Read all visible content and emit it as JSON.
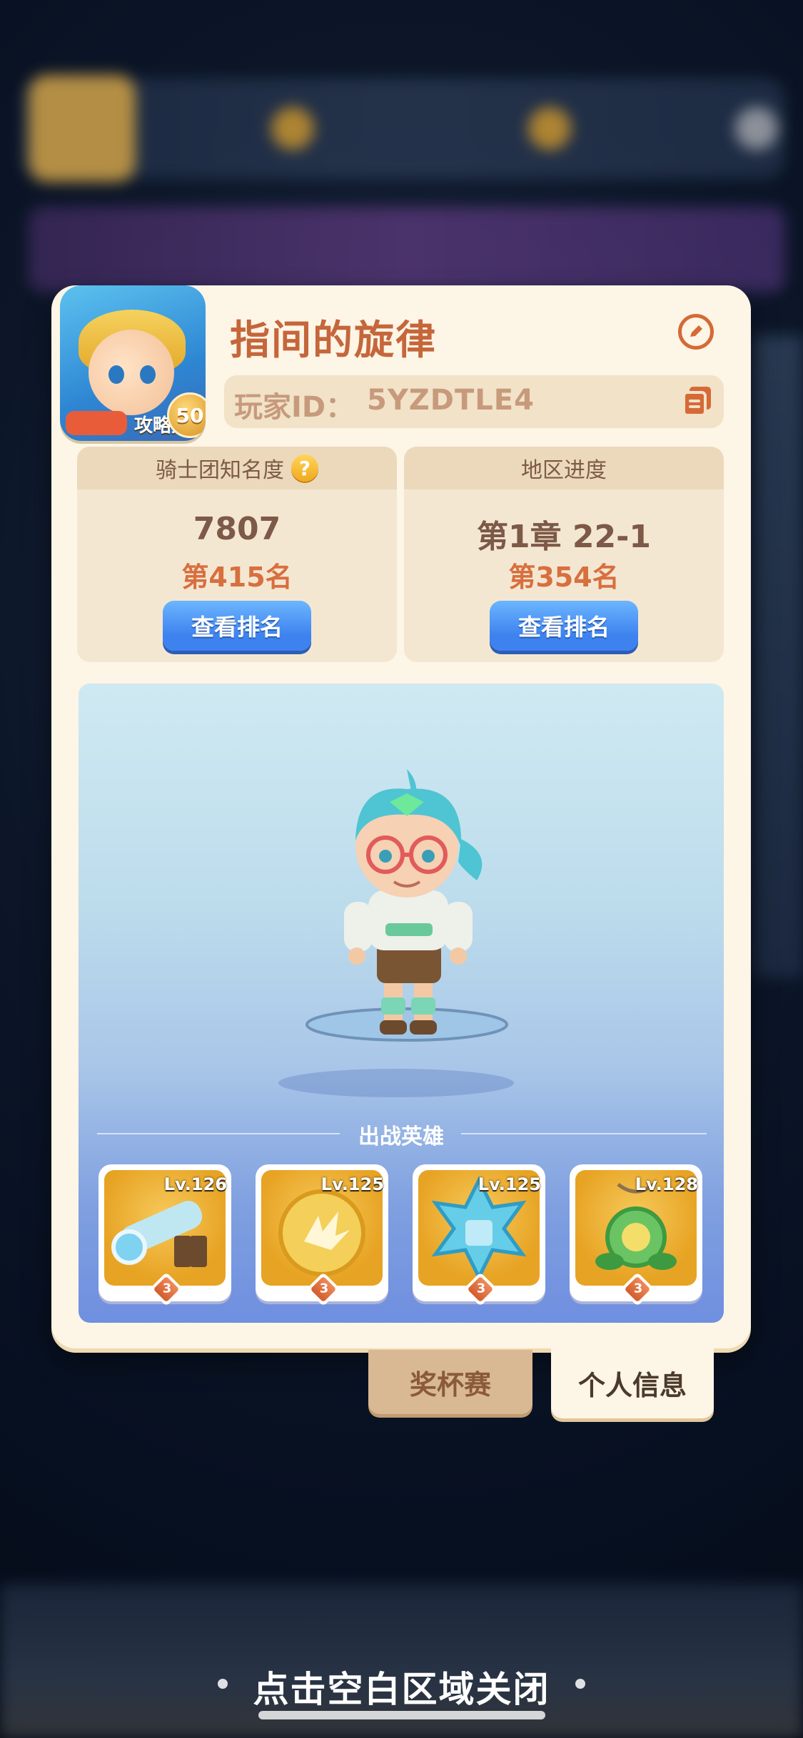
{
  "profile": {
    "name": "指间的旋律",
    "id_label": "玩家ID：",
    "id_value": "5YZDTLE4",
    "avatar_level": "50",
    "avatar_caption": "攻略大"
  },
  "stats": {
    "left": {
      "title": "骑士团知名度",
      "value": "7807",
      "rank": "第415名",
      "button": "查看排名"
    },
    "right": {
      "title": "地区进度",
      "value": "第1章 22-1",
      "rank": "第354名",
      "button": "查看排名"
    }
  },
  "showcase": {
    "section_title": "出战英雄",
    "heroes": [
      {
        "level": "Lv.126",
        "stars": "3",
        "icon": "cannon-icon"
      },
      {
        "level": "Lv.125",
        "stars": "3",
        "icon": "explosion-orb-icon"
      },
      {
        "level": "Lv.125",
        "stars": "3",
        "icon": "ice-star-icon"
      },
      {
        "level": "Lv.128",
        "stars": "3",
        "icon": "green-pendant-icon"
      }
    ]
  },
  "tabs": {
    "trophy": "奖杯赛",
    "profile": "个人信息"
  },
  "hint": {
    "close": "点击空白区域关闭"
  },
  "colors": {
    "card_bg": "#fdf5e6",
    "name_color": "#c5663b",
    "rank_color": "#d86f3f",
    "button_blue": "#3d82ee"
  }
}
